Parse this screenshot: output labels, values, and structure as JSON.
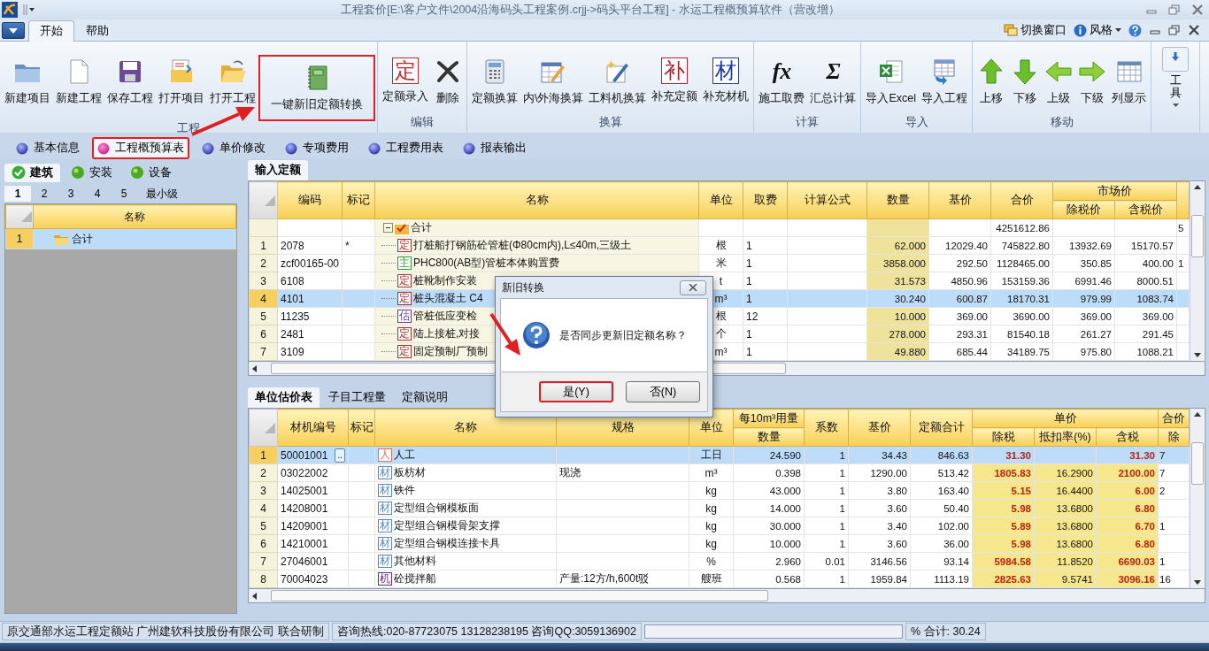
{
  "window": {
    "title": "工程套价[E:\\客户文件\\2004沿海码头工程案例.crjj->码头平台工程] - 水运工程概预算软件（营改增）"
  },
  "ribbon": {
    "tabs": [
      {
        "label": "开始",
        "selected": true
      },
      {
        "label": "帮助",
        "selected": false
      }
    ],
    "switch_window": "切换窗口",
    "style_menu": "风格",
    "groups": [
      {
        "label": "工程",
        "buttons": [
          {
            "label": "新建项目",
            "kind": "folder",
            "marked": false
          },
          {
            "label": "新建工程",
            "kind": "page",
            "marked": false
          },
          {
            "label": "保存工程",
            "kind": "floppy",
            "marked": false
          },
          {
            "label": "打开项目",
            "kind": "open-doc",
            "marked": false
          },
          {
            "label": "打开工程",
            "kind": "open-folder",
            "marked": false
          },
          {
            "label": "一键新旧定额转换",
            "kind": "notebook",
            "marked": true
          }
        ]
      },
      {
        "label": "编辑",
        "buttons": [
          {
            "label": "定额录入",
            "kind": "glyph",
            "glyph": "定",
            "color": "#c0282c",
            "marked": false
          },
          {
            "label": "删除",
            "kind": "cross",
            "marked": false
          }
        ]
      },
      {
        "label": "换算",
        "buttons": [
          {
            "label": "定额换算",
            "kind": "calculator",
            "marked": false
          },
          {
            "label": "内\\外海换算",
            "kind": "table-pencil",
            "marked": false
          },
          {
            "label": "工料机换算",
            "kind": "pencil",
            "marked": false
          },
          {
            "label": "补充定额",
            "kind": "glyph",
            "glyph": "补",
            "color": "#b02030",
            "marked": false
          },
          {
            "label": "补充材机",
            "kind": "glyph",
            "glyph": "材",
            "color": "#203a9a",
            "marked": false
          }
        ]
      },
      {
        "label": "计算",
        "buttons": [
          {
            "label": "施工取费",
            "kind": "symbol",
            "glyph": "fx",
            "marked": false
          },
          {
            "label": "汇总计算",
            "kind": "symbol",
            "glyph": "Σ",
            "marked": false
          }
        ]
      },
      {
        "label": "导入",
        "buttons": [
          {
            "label": "导入Excel",
            "kind": "excel",
            "marked": false
          },
          {
            "label": "导入工程",
            "kind": "import",
            "marked": false
          }
        ]
      },
      {
        "label": "移动",
        "buttons": [
          {
            "label": "上移",
            "kind": "up",
            "marked": false
          },
          {
            "label": "下移",
            "kind": "down",
            "marked": false
          },
          {
            "label": "上级",
            "kind": "left",
            "marked": false
          },
          {
            "label": "下级",
            "kind": "right",
            "marked": false
          },
          {
            "label": "列显示",
            "kind": "grid",
            "marked": false
          }
        ]
      }
    ],
    "tool_button": "工具"
  },
  "nav_tabs": [
    {
      "label": "基本信息",
      "selected": false,
      "marked": false
    },
    {
      "label": "工程概预算表",
      "selected": true,
      "marked": true
    },
    {
      "label": "单价修改",
      "selected": false,
      "marked": false
    },
    {
      "label": "专项费用",
      "selected": false,
      "marked": false
    },
    {
      "label": "工程费用表",
      "selected": false,
      "marked": false
    },
    {
      "label": "报表输出",
      "selected": false,
      "marked": false
    }
  ],
  "left_panel": {
    "categories": [
      {
        "label": "建筑",
        "selected": true
      },
      {
        "label": "安装",
        "selected": false
      },
      {
        "label": "设备",
        "selected": false
      }
    ],
    "levels": [
      {
        "label": "1",
        "selected": true
      },
      {
        "label": "2",
        "selected": false
      },
      {
        "label": "3",
        "selected": false
      },
      {
        "label": "4",
        "selected": false
      },
      {
        "label": "5",
        "selected": false
      },
      {
        "label": "最小级",
        "selected": false
      }
    ],
    "tree": {
      "column": "名称",
      "rows": [
        {
          "number": "1",
          "name": "合计",
          "selected": true
        }
      ]
    }
  },
  "workarea": {
    "upper_tabs": [
      {
        "label": "输入定额",
        "selected": true
      }
    ],
    "upper_table": {
      "columns": [
        {
          "label": "编码",
          "kind": "code"
        },
        {
          "label": "标记",
          "kind": "mark"
        },
        {
          "label": "名称",
          "kind": "name"
        },
        {
          "label": "单位",
          "kind": "unit"
        },
        {
          "label": "取费",
          "kind": "code"
        },
        {
          "label": "计算公式",
          "kind": "code"
        },
        {
          "label": "数量",
          "kind": "qty"
        },
        {
          "label": "基价",
          "kind": "num"
        },
        {
          "label": "合价",
          "kind": "num"
        },
        {
          "label": "市场价",
          "kind": "group",
          "colspan": 2,
          "children": [
            {
              "label": "除税价",
              "kind": "num"
            },
            {
              "label": "含税价",
              "kind": "num"
            }
          ]
        },
        {
          "kind": "cut"
        }
      ],
      "rows": [
        {
          "kind": "total",
          "selected": false,
          "cells": [
            null,
            null,
            "合计",
            null,
            null,
            null,
            null,
            null,
            "4251612.86",
            null,
            null,
            "5"
          ]
        },
        {
          "kind": "item",
          "number": "1",
          "selected": false,
          "tag": "定",
          "color": "#a8302a",
          "cells": [
            "2078",
            "*",
            "打桩船打钢筋砼管桩(Φ80cm内),L≤40m,三级土",
            "根",
            "1",
            null,
            "62.000",
            "12029.40",
            "745822.80",
            "13932.69",
            "15170.57",
            null
          ]
        },
        {
          "kind": "item",
          "number": "2",
          "selected": false,
          "tag": "主",
          "color": "#2e9a3a",
          "cells": [
            "zcf00165-00",
            null,
            "PHC800(AB型)管桩本体购置费",
            "米",
            "1",
            null,
            "3858.000",
            "292.50",
            "1128465.00",
            "350.85",
            "400.00",
            "1"
          ]
        },
        {
          "kind": "item",
          "number": "3",
          "selected": false,
          "tag": "定",
          "color": "#a8302a",
          "cells": [
            "6108",
            null,
            "桩靴制作安装",
            "t",
            "1",
            null,
            "31.573",
            "4850.96",
            "153159.36",
            "6991.46",
            "8000.51",
            null
          ]
        },
        {
          "kind": "item",
          "number": "4",
          "selected": true,
          "tag": "定",
          "color": "#a8302a",
          "cells": [
            "4101",
            null,
            "桩头混凝土 C4",
            "m³",
            "1",
            null,
            "30.240",
            "600.87",
            "18170.31",
            "979.99",
            "1083.74",
            null
          ]
        },
        {
          "kind": "item",
          "number": "5",
          "selected": false,
          "tag": "估",
          "color": "#6a3aa0",
          "cells": [
            "11235",
            null,
            "管桩低应变检",
            "根",
            "12",
            null,
            "10.000",
            "369.00",
            "3690.00",
            "369.00",
            "369.00",
            null
          ]
        },
        {
          "kind": "item",
          "number": "6",
          "selected": false,
          "tag": "定",
          "color": "#a8302a",
          "cells": [
            "2481",
            null,
            "陆上接桩,对接",
            "个",
            "1",
            null,
            "278.000",
            "293.31",
            "81540.18",
            "261.27",
            "291.45",
            null
          ]
        },
        {
          "kind": "item",
          "number": "7",
          "selected": false,
          "tag": "定",
          "color": "#a8302a",
          "cells": [
            "3109",
            null,
            "固定预制厂预制",
            "m³",
            "1",
            null,
            "49.880",
            "685.44",
            "34189.75",
            "975.80",
            "1088.21",
            null
          ]
        }
      ]
    },
    "lower_tabs": [
      {
        "label": "单位估价表",
        "selected": true
      },
      {
        "label": "子目工程量",
        "selected": false
      },
      {
        "label": "定额说明",
        "selected": false
      }
    ],
    "lower_table": {
      "columns": [
        {
          "label": "材机编号",
          "kind": "code"
        },
        {
          "label": "标记",
          "kind": "mark"
        },
        {
          "label": "名称",
          "kind": "name"
        },
        {
          "label": "规格",
          "kind": "code"
        },
        {
          "label": "单位",
          "kind": "unit"
        },
        {
          "label": "每10m³用量",
          "kind": "group",
          "children": [
            {
              "label": "数量",
              "kind": "num"
            }
          ]
        },
        {
          "label": "系数",
          "kind": "num"
        },
        {
          "label": "基价",
          "kind": "num"
        },
        {
          "label": "定额合计",
          "kind": "num"
        },
        {
          "label": "单价",
          "kind": "group",
          "colspan": 3,
          "children": [
            {
              "label": "除税",
              "kind": "price"
            },
            {
              "label": "抵扣率(%)",
              "kind": "rate"
            },
            {
              "label": "含税",
              "kind": "price"
            }
          ]
        },
        {
          "label": "合价",
          "kind": "group",
          "children": [
            {
              "label": "除",
              "kind": "cut"
            }
          ]
        }
      ],
      "rows": [
        {
          "kind": "item",
          "number": "1",
          "selected": true,
          "picker": "..",
          "tag": "人",
          "color": "#e0705a",
          "cells": [
            "50001001",
            null,
            "人工",
            null,
            "工日",
            "24.590",
            "1",
            "34.43",
            "846.63",
            "31.30",
            null,
            "31.30",
            "7"
          ]
        },
        {
          "kind": "item",
          "number": "2",
          "selected": false,
          "tag": "材",
          "color": "#5a86b8",
          "cells": [
            "03022002",
            null,
            "板枋材",
            "现浇",
            "m³",
            "0.398",
            "1",
            "1290.00",
            "513.42",
            "1805.83",
            "16.2900",
            "2100.00",
            "7"
          ]
        },
        {
          "kind": "item",
          "number": "3",
          "selected": false,
          "tag": "材",
          "color": "#5a86b8",
          "cells": [
            "14025001",
            null,
            "铁件",
            null,
            "kg",
            "43.000",
            "1",
            "3.80",
            "163.40",
            "5.15",
            "16.4400",
            "6.00",
            "2"
          ]
        },
        {
          "kind": "item",
          "number": "4",
          "selected": false,
          "tag": "材",
          "color": "#5a86b8",
          "cells": [
            "14208001",
            null,
            "定型组合钢模板面",
            null,
            "kg",
            "14.000",
            "1",
            "3.60",
            "50.40",
            "5.98",
            "13.6800",
            "6.80",
            null
          ]
        },
        {
          "kind": "item",
          "number": "5",
          "selected": false,
          "tag": "材",
          "color": "#5a86b8",
          "cells": [
            "14209001",
            null,
            "定型组合钢模骨架支撑",
            null,
            "kg",
            "30.000",
            "1",
            "3.40",
            "102.00",
            "5.89",
            "13.6800",
            "6.70",
            "1"
          ]
        },
        {
          "kind": "item",
          "number": "6",
          "selected": false,
          "tag": "材",
          "color": "#5a86b8",
          "cells": [
            "14210001",
            null,
            "定型组合钢模连接卡具",
            null,
            "kg",
            "10.000",
            "1",
            "3.60",
            "36.00",
            "5.98",
            "13.6800",
            "6.80",
            null
          ]
        },
        {
          "kind": "item",
          "number": "7",
          "selected": false,
          "tag": "材",
          "color": "#5a86b8",
          "cells": [
            "27046001",
            null,
            "其他材料",
            null,
            "%",
            "2.960",
            "0.01",
            "3146.56",
            "93.14",
            "5984.58",
            "11.8520",
            "6690.03",
            "1"
          ]
        },
        {
          "kind": "item",
          "number": "8",
          "selected": false,
          "tag": "机",
          "color": "#6a2a8a",
          "cells": [
            "70004023",
            null,
            "砼搅拌船",
            "产量:12方/h,600t驳",
            "艘班",
            "0.568",
            "1",
            "1959.84",
            "1113.19",
            "2825.63",
            "9.5741",
            "3096.16",
            "16"
          ]
        }
      ]
    }
  },
  "status_bar": {
    "segments": [
      "原交通部水运工程定额站 广州建软科技股份有限公司 联合研制",
      "咨询热线:020-87723075 13128238195 咨询QQ:3059136902"
    ],
    "total": "% 合计: 30.24"
  },
  "dialog": {
    "title": "新旧转换",
    "message": "是否同步更新旧定额名称？",
    "buttons": [
      {
        "label": "是(Y)",
        "focused": true,
        "marked": true
      },
      {
        "label": "否(N)",
        "focused": false,
        "marked": false
      }
    ]
  }
}
